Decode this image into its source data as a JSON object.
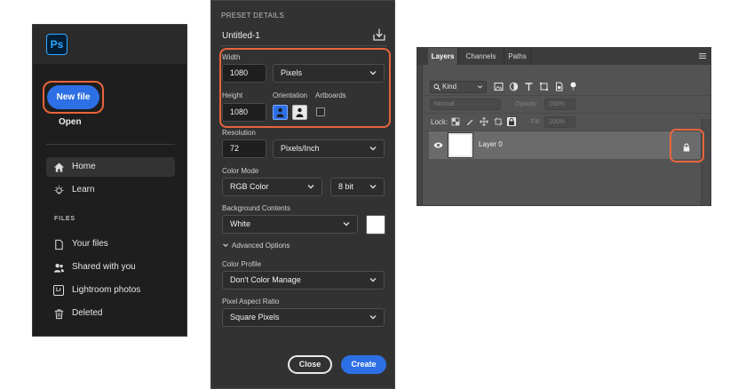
{
  "colors": {
    "accent_blue": "#2d6fe5",
    "highlight_orange": "#e8643c",
    "ps_logo_bg": "#001e36",
    "ps_logo_fg": "#31a8ff"
  },
  "home": {
    "logo_text": "Ps",
    "new_file_label": "New file",
    "open_label": "Open",
    "nav": [
      {
        "label": "Home",
        "icon": "home-icon"
      },
      {
        "label": "Learn",
        "icon": "lightbulb-icon"
      }
    ],
    "files_header": "FILES",
    "files": [
      {
        "label": "Your files",
        "icon": "file-icon"
      },
      {
        "label": "Shared with you",
        "icon": "people-icon"
      },
      {
        "label": "Lightroom photos",
        "icon": "lightroom-icon",
        "badge": "Lr"
      },
      {
        "label": "Deleted",
        "icon": "trash-icon"
      }
    ]
  },
  "preset": {
    "header": "PRESET DETAILS",
    "name": "Untitled-1",
    "width_label": "Width",
    "width_value": "1080",
    "width_unit": "Pixels",
    "height_label": "Height",
    "height_value": "1080",
    "orientation_label": "Orientation",
    "artboards_label": "Artboards",
    "resolution_label": "Resolution",
    "resolution_value": "72",
    "resolution_unit": "Pixels/Inch",
    "color_mode_label": "Color Mode",
    "color_mode_value": "RGB Color",
    "bit_depth_value": "8 bit",
    "background_label": "Background Contents",
    "background_value": "White",
    "background_swatch": "#ffffff",
    "advanced_label": "Advanced Options",
    "color_profile_label": "Color Profile",
    "color_profile_value": "Don't Color Manage",
    "pixel_aspect_label": "Pixel Aspect Ratio",
    "pixel_aspect_value": "Square Pixels",
    "close_label": "Close",
    "create_label": "Create"
  },
  "layers_panel": {
    "tabs": [
      "Layers",
      "Channels",
      "Paths"
    ],
    "kind_label": "Kind",
    "blend_mode": "Normal",
    "opacity_label": "Opacity:",
    "opacity_value": "100%",
    "lock_label": "Lock:",
    "fill_label": "Fill:",
    "fill_value": "100%",
    "layer_name": "Layer 0"
  }
}
